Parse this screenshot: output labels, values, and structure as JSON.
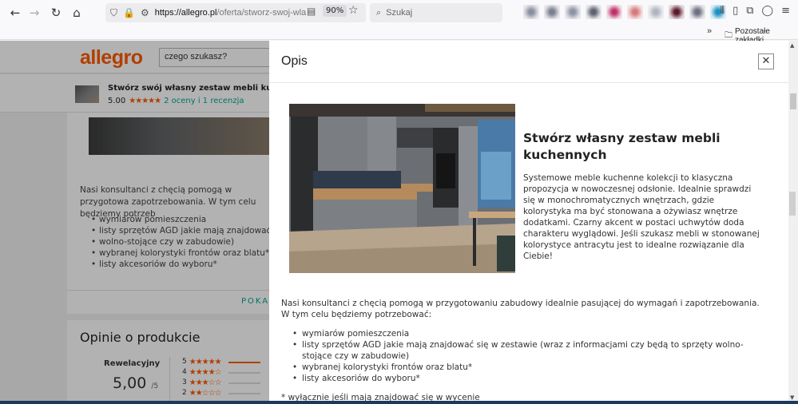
{
  "browser": {
    "url_main": "https://allegro.pl",
    "url_rest": "/oferta/stworz-swoj-wla",
    "zoom": "90%",
    "search_placeholder": "Szukaj",
    "bookmarks_folder": "Pozostałe zakładki"
  },
  "site": {
    "logo": "allegro",
    "search_placeholder": "czego szukasz?",
    "product_title": "Stwórz swój własny zestaw mebli kuchenny",
    "rating_value": "5.00",
    "rating_stars": "★★★★★",
    "rating_link": "2 oceny i 1 recenzja",
    "bg_text": "Nasi konsultanci z chęcią pomogą w przygotowa zapotrzebowania. W tym celu będziemy potrzeb",
    "bg_list": [
      "wymiarów pomieszczenia",
      "listy sprzętów AGD jakie mają znajdować się",
      "wolno-stojące czy w zabudowie)",
      "wybranej kolorystyki frontów oraz blatu*",
      "listy akcesoriów do wyboru*"
    ],
    "show_more": "POKAZ",
    "opinions_title": "Opinie o produkcie",
    "opinions_label": "Rewelacyjny",
    "opinions_score": "5,00",
    "opinions_scale": "/5",
    "rating_rows": [
      {
        "n": "5",
        "stars": "★★★★★"
      },
      {
        "n": "4",
        "stars": "★★★★☆"
      },
      {
        "n": "3",
        "stars": "★★★☆☆"
      },
      {
        "n": "2",
        "stars": "★★☆☆☆"
      }
    ]
  },
  "modal": {
    "title": "Opis",
    "close": "✕",
    "heading": "Stwórz własny zestaw mebli kuchennych",
    "paragraph": "Systemowe meble kuchenne kolekcji                to klasyczna propozycja w nowoczesnej odsłonie. Idealnie sprawdzi się w monochromatycznych wnętrzach, gdzie kolorystyka ma być stonowana a ożywiasz wnętrze dodatkami. Czarny akcent w postaci uchwytów doda charakteru wyglądowi. Jeśli szukasz mebli w stonowanej kolorystyce antracytu jest to idealne rozwiązanie dla Ciebie!",
    "paragraph2": "Nasi konsultanci z chęcią pomogą w przygotowaniu zabudowy idealnie pasującej do wymagań i zapotrzebowania. W tym celu będziemy potrzebować:",
    "list": [
      "wymiarów pomieszczenia",
      "listy sprzętów AGD jakie mają znajdować się w zestawie (wraz z informacjami czy będą to sprzęty wolno-stojące czy w zabudowie)",
      "wybranej kolorystyki frontów oraz blatu*",
      "listy akcesoriów do wyboru*"
    ],
    "footnote": "* wyłącznie jeśli mają znajdować się w wycenie"
  },
  "colors": {
    "brand": "#ff5a00",
    "link": "#00a790"
  }
}
